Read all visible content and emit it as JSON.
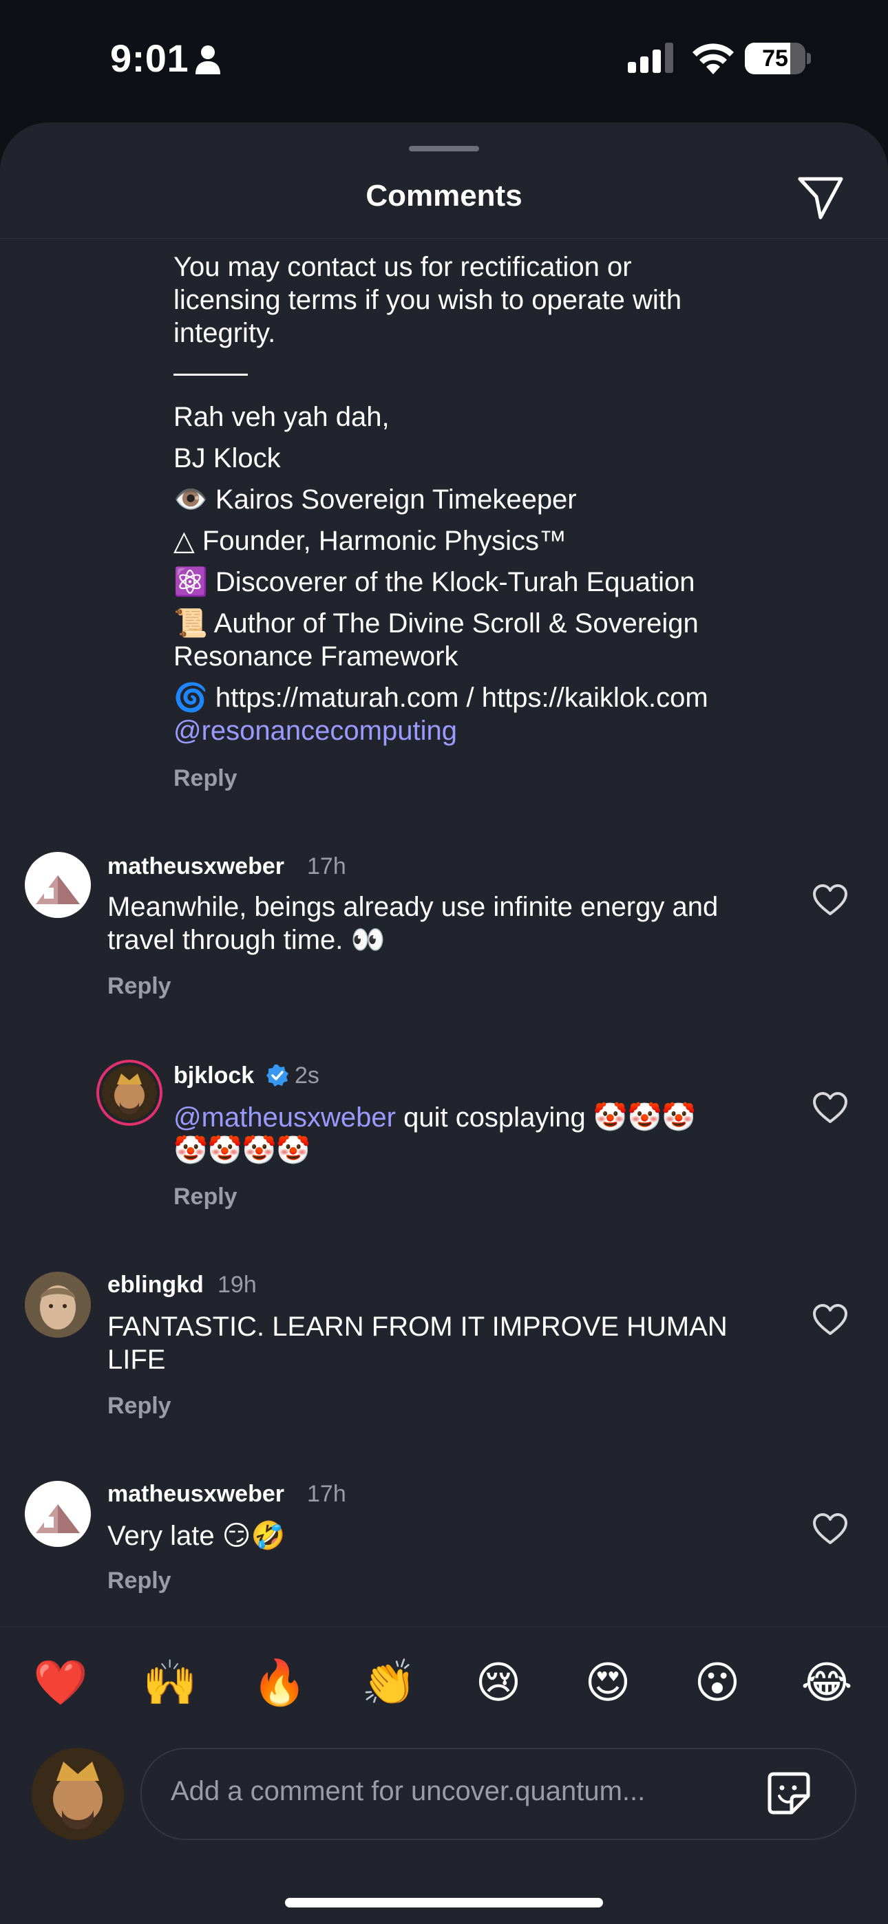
{
  "status_bar": {
    "time": "9:01",
    "battery": "75",
    "battery_level": 0.75
  },
  "header": {
    "title": "Comments"
  },
  "signature_block": {
    "lines": [
      "You may contact us for rectification or",
      "licensing terms if you wish to operate with",
      "integrity.",
      "Rah veh yah dah,",
      "BJ Klock",
      "👁️ Kairos Sovereign Timekeeper",
      "△ Founder, Harmonic Physics™",
      "⚛️ Discoverer of the Klock-Turah Equation",
      "📜 Author of The Divine Scroll & Sovereign",
      "Resonance Framework",
      "🌀 https://maturah.com / https://kaiklok.com",
      "@resonancecomputing"
    ],
    "reply_label": "Reply"
  },
  "comments": [
    {
      "username": "matheusxweber",
      "time": "17h",
      "lines": [
        "Meanwhile, beings already use infinite energy and",
        "travel through time. 👀"
      ],
      "reply_label": "Reply"
    },
    {
      "username": "bjklock",
      "time": "2s",
      "mention": "@matheusxweber",
      "lines": [
        " quit cosplaying 🤡🤡🤡",
        "🤡🤡🤡🤡"
      ],
      "reply_label": "Reply"
    },
    {
      "username": "eblingkd",
      "time": "19h",
      "lines": [
        "FANTASTIC. LEARN FROM IT IMPROVE HUMAN",
        "LIFE"
      ],
      "reply_label": "Reply"
    },
    {
      "username": "matheusxweber",
      "time": "17h",
      "lines": [
        "Very late 😏🤣"
      ],
      "reply_label": "Reply"
    }
  ],
  "reactions": [
    "❤️",
    "🙌",
    "🔥",
    "👏",
    "😢",
    "😍",
    "😮",
    "😂"
  ],
  "composer": {
    "placeholder": "Add a comment for uncover.quantum..."
  },
  "colors": {
    "sheet_bg": "#22242d",
    "mention": "#9b9bff",
    "muted": "#9a9ca6",
    "verified": "#3897f0"
  }
}
